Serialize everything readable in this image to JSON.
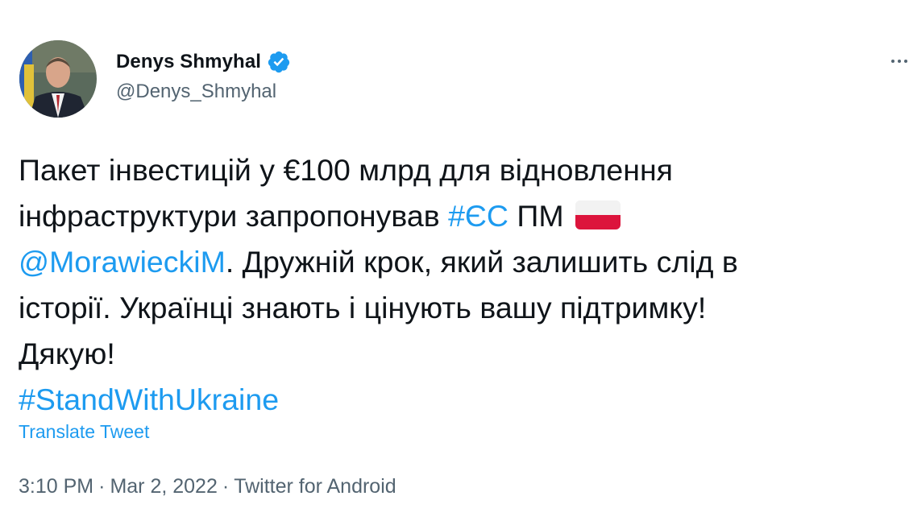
{
  "author": {
    "name": "Denys Shmyhal",
    "handle": "@Denys_Shmyhal",
    "verified": true
  },
  "tweet": {
    "line1": "Пакет інвестицій у €100 млрд  для відновлення",
    "line2_pre": "інфраструктури запропонував ",
    "hashtag_eu": "#ЄС",
    "line2_mid": " ПМ ",
    "flag": "poland-flag",
    "mention": "@MorawieckiM",
    "line3_post": ". Дружній крок, який залишить слід в",
    "line4": "історії. Українці знають і цінують вашу підтримку!",
    "line5": "Дякую!",
    "hashtag_stand": "#StandWithUkraine"
  },
  "translate_label": "Translate Tweet",
  "meta": {
    "time": "3:10 PM",
    "separator": "·",
    "date": "Mar 2, 2022",
    "source": "Twitter for Android"
  },
  "colors": {
    "text": "#0f1419",
    "secondary": "#536471",
    "link": "#1d9bf0",
    "verified": "#1d9bf0"
  }
}
